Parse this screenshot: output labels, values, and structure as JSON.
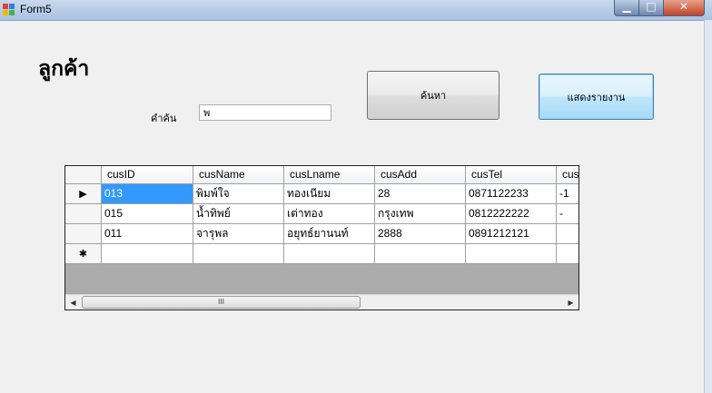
{
  "window": {
    "title": "Form5",
    "minimize_glyph": "▁",
    "maximize_glyph": "□",
    "close_glyph": "✕",
    "colors": {
      "titlebar": "#b8cde8",
      "close": "#c7503a"
    }
  },
  "form": {
    "heading": "ลูกค้า",
    "search_label": "คำค้น",
    "search_value": "พ",
    "search_button": "ค้นหา",
    "report_button": "แสดงรายงาน"
  },
  "grid": {
    "columns": [
      "cusID",
      "cusName",
      "cusLname",
      "cusAdd",
      "cusTel",
      "cus"
    ],
    "rows": [
      {
        "indicator": "▶",
        "cells": [
          "013",
          "พิมพ์ใจ",
          "ทองเนียม",
          "28",
          "0871122233",
          "-1"
        ]
      },
      {
        "indicator": "",
        "cells": [
          "015",
          "น้ำทิพย์",
          "เต่าทอง",
          "กรุงเทพ",
          "0812222222",
          "-"
        ]
      },
      {
        "indicator": "",
        "cells": [
          "011",
          "จารุพล",
          "อยุทธ์ยานนท์",
          "2888",
          "0891212121",
          ""
        ]
      }
    ],
    "new_row_indicator": "✱",
    "selected_color": "#3399ff",
    "scroll": {
      "left": "◀",
      "right": "▶",
      "thumb": "III"
    }
  }
}
